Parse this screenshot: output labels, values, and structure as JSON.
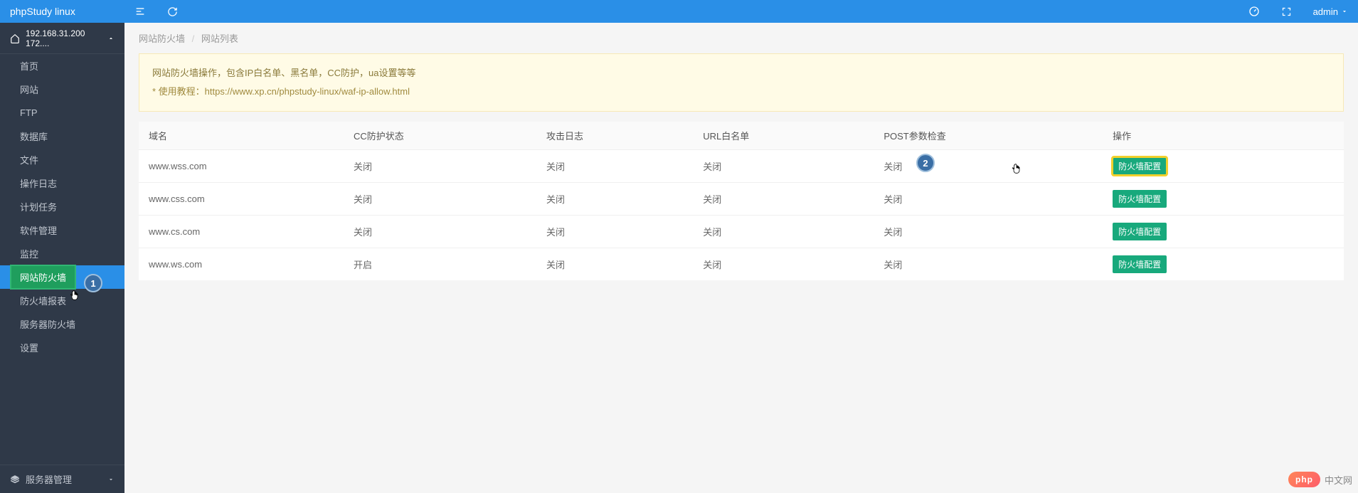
{
  "brand": "phpStudy linux",
  "server_label": "192.168.31.200 172....",
  "sidebar": {
    "items": [
      {
        "label": "首页"
      },
      {
        "label": "网站"
      },
      {
        "label": "FTP"
      },
      {
        "label": "数据库"
      },
      {
        "label": "文件"
      },
      {
        "label": "操作日志"
      },
      {
        "label": "计划任务"
      },
      {
        "label": "软件管理"
      },
      {
        "label": "监控"
      },
      {
        "label": "网站防火墙"
      },
      {
        "label": "防火墙报表"
      },
      {
        "label": "服务器防火墙"
      },
      {
        "label": "设置"
      }
    ],
    "footer_label": "服务器管理"
  },
  "topbar": {
    "user_label": "admin"
  },
  "breadcrumb": {
    "a": "网站防火墙",
    "b": "网站列表"
  },
  "info_box": {
    "line1": "网站防火墙操作，包含IP白名单、黑名单，CC防护，ua设置等等",
    "line2_prefix": "* 使用教程：",
    "line2_url": "https://www.xp.cn/phpstudy-linux/waf-ip-allow.html"
  },
  "table": {
    "headers": [
      "域名",
      "CC防护状态",
      "攻击日志",
      "URL白名单",
      "POST参数检查",
      "操作"
    ],
    "action_label": "防火墙配置",
    "rows": [
      {
        "domain": "www.wss.com",
        "cc": "关闭",
        "log": "关闭",
        "whitelist": "关闭",
        "post": "关闭"
      },
      {
        "domain": "www.css.com",
        "cc": "关闭",
        "log": "关闭",
        "whitelist": "关闭",
        "post": "关闭"
      },
      {
        "domain": "www.cs.com",
        "cc": "关闭",
        "log": "关闭",
        "whitelist": "关闭",
        "post": "关闭"
      },
      {
        "domain": "www.ws.com",
        "cc": "开启",
        "log": "关闭",
        "whitelist": "关闭",
        "post": "关闭"
      }
    ]
  },
  "callouts": {
    "one": "1",
    "two": "2"
  },
  "watermark": {
    "badge": "php",
    "text": "中文网"
  }
}
